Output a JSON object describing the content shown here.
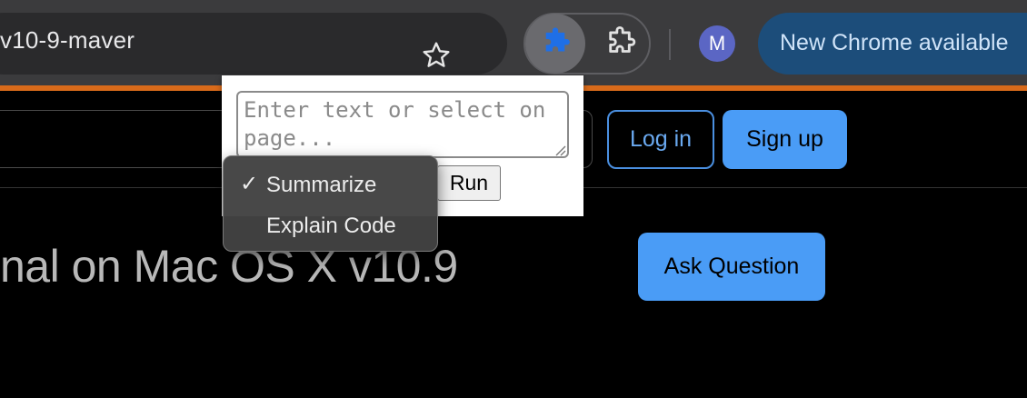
{
  "browser": {
    "omnibox_text": "v10-9-maver",
    "avatar_initial": "M",
    "update_label": "New Chrome available",
    "colors": {
      "toolbar": "#3b3b3d",
      "accent_line": "#d86a1a",
      "update_pill": "#1c4d7a",
      "avatar": "#5b66c4"
    },
    "icons": [
      "star-icon",
      "puzzle-icon",
      "extensions-icon"
    ]
  },
  "page": {
    "login_label": "Log in",
    "signup_label": "Sign up",
    "title": "nal on Mac OS X v10.9",
    "ask_label": "Ask Question",
    "colors": {
      "primary_button": "#4a9cf6"
    }
  },
  "popup": {
    "textarea_placeholder": "Enter text or select on page...",
    "run_label": "Run"
  },
  "dropdown": {
    "selected": "Summarize",
    "check_glyph": "✓",
    "options": [
      {
        "label": "Summarize",
        "selected": true
      },
      {
        "label": "Explain Code",
        "selected": false
      }
    ]
  }
}
